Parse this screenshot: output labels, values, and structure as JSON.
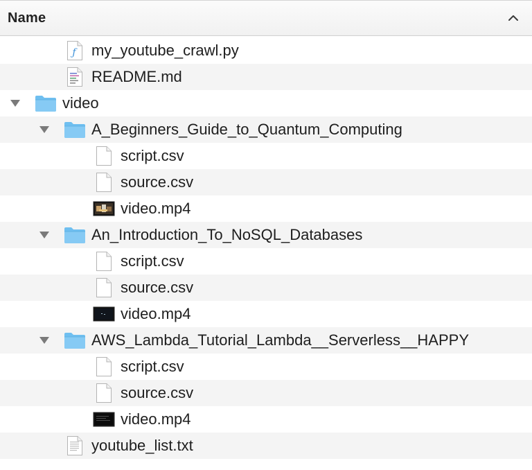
{
  "header": {
    "column_title": "Name",
    "sort_direction": "ascending"
  },
  "rows": [
    {
      "name": "my_youtube_crawl.py",
      "kind": "python-file",
      "level": 1
    },
    {
      "name": "README.md",
      "kind": "markdown-file",
      "level": 1
    },
    {
      "name": "video",
      "kind": "folder",
      "level": 0,
      "expanded": true
    },
    {
      "name": "A_Beginners_Guide_to_Quantum_Computing",
      "kind": "folder",
      "level": 1,
      "expanded": true
    },
    {
      "name": "script.csv",
      "kind": "csv-file",
      "level": 2
    },
    {
      "name": "source.csv",
      "kind": "csv-file",
      "level": 2
    },
    {
      "name": "video.mp4",
      "kind": "video-file",
      "level": 2,
      "thumbnail": "colorful"
    },
    {
      "name": "An_Introduction_To_NoSQL_Databases",
      "kind": "folder",
      "level": 1,
      "expanded": true
    },
    {
      "name": "script.csv",
      "kind": "csv-file",
      "level": 2
    },
    {
      "name": "source.csv",
      "kind": "csv-file",
      "level": 2
    },
    {
      "name": "video.mp4",
      "kind": "video-file",
      "level": 2,
      "thumbnail": "dark"
    },
    {
      "name": "AWS_Lambda_Tutorial_Lambda__Serverless__HAPPY",
      "kind": "folder",
      "level": 1,
      "expanded": true
    },
    {
      "name": "script.csv",
      "kind": "csv-file",
      "level": 2
    },
    {
      "name": "source.csv",
      "kind": "csv-file",
      "level": 2
    },
    {
      "name": "video.mp4",
      "kind": "video-file",
      "level": 2,
      "thumbnail": "terminal"
    },
    {
      "name": "youtube_list.txt",
      "kind": "text-file",
      "level": 1
    }
  ],
  "colors": {
    "folder": "#6fbff0",
    "row_alt": "#f4f4f4",
    "text": "#1e1e1e",
    "disclosure": "#7a7a7a"
  }
}
